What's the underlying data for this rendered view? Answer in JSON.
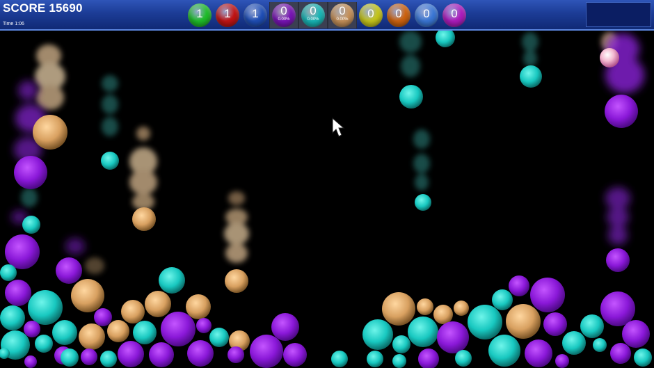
{
  "hud": {
    "score_text": "SCORE 15690",
    "time_text": "Time 1:06",
    "counters": [
      {
        "name": "green",
        "color": "#1fbf2a",
        "value": "1",
        "percent": ""
      },
      {
        "name": "red",
        "color": "#c41414",
        "value": "1",
        "percent": ""
      },
      {
        "name": "blue",
        "color": "#1f4fb8",
        "value": "1",
        "percent": ""
      },
      {
        "name": "purple",
        "color": "#7a14b8",
        "value": "0",
        "percent": "0.00%"
      },
      {
        "name": "cyan",
        "color": "#18b8b8",
        "value": "0",
        "percent": "0.00%"
      },
      {
        "name": "tan",
        "color": "#c8925a",
        "value": "0",
        "percent": "0.00%"
      },
      {
        "name": "yellow",
        "color": "#c8c81a",
        "value": "0",
        "percent": ""
      },
      {
        "name": "orange",
        "color": "#d0640f",
        "value": "0",
        "percent": ""
      },
      {
        "name": "light-blue",
        "color": "#3b78d8",
        "value": "0",
        "percent": ""
      },
      {
        "name": "magenta",
        "color": "#b01cc0",
        "value": "0",
        "percent": ""
      }
    ]
  },
  "colors": {
    "purple": "#9a22e6",
    "cyan": "#1ed8d0",
    "tan": "#e8b070",
    "pink": "#f0a0c0",
    "background": "#000000",
    "hud_blue": "#1c3c96"
  }
}
